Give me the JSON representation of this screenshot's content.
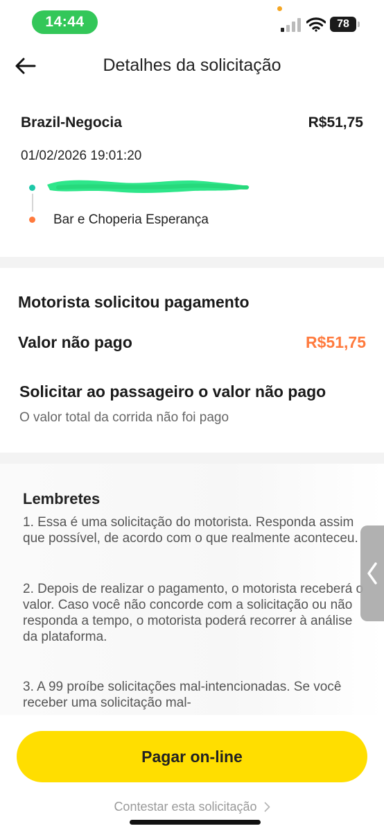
{
  "status_bar": {
    "time": "14:44",
    "battery": "78"
  },
  "header": {
    "title": "Detalhes da solicitação"
  },
  "trip": {
    "name": "Brazil-Negocia",
    "price": "R$51,75",
    "datetime": "01/02/2026 19:01:20",
    "destination": "Bar e Choperia Esperança"
  },
  "payment": {
    "heading": "Motorista solicitou pagamento",
    "unpaid_label": "Valor não pago",
    "unpaid_value": "R$51,75",
    "request_title": "Solicitar ao passageiro o valor não pago",
    "request_desc": "O valor total da corrida não foi pago"
  },
  "reminders": {
    "title": "Lembretes",
    "items": [
      "1. Essa é uma solicitação do motorista. Responda assim que possível, de acordo com o que realmente aconteceu.",
      "2. Depois de realizar o pagamento, o motorista receberá o valor. Caso você não concorde com a solicitação ou não responda a tempo, o motorista poderá recorrer à análise da plataforma.",
      "3. A 99 proíbe solicitações mal-intencionadas. Se você receber uma solicitação mal-"
    ]
  },
  "actions": {
    "pay_label": "Pagar on-line",
    "contest_label": "Contestar esta solicitação"
  },
  "colors": {
    "accent_yellow": "#ffde00",
    "accent_orange": "#ff7a3d",
    "status_green": "#33c759",
    "route_green": "#1dc8a8"
  }
}
